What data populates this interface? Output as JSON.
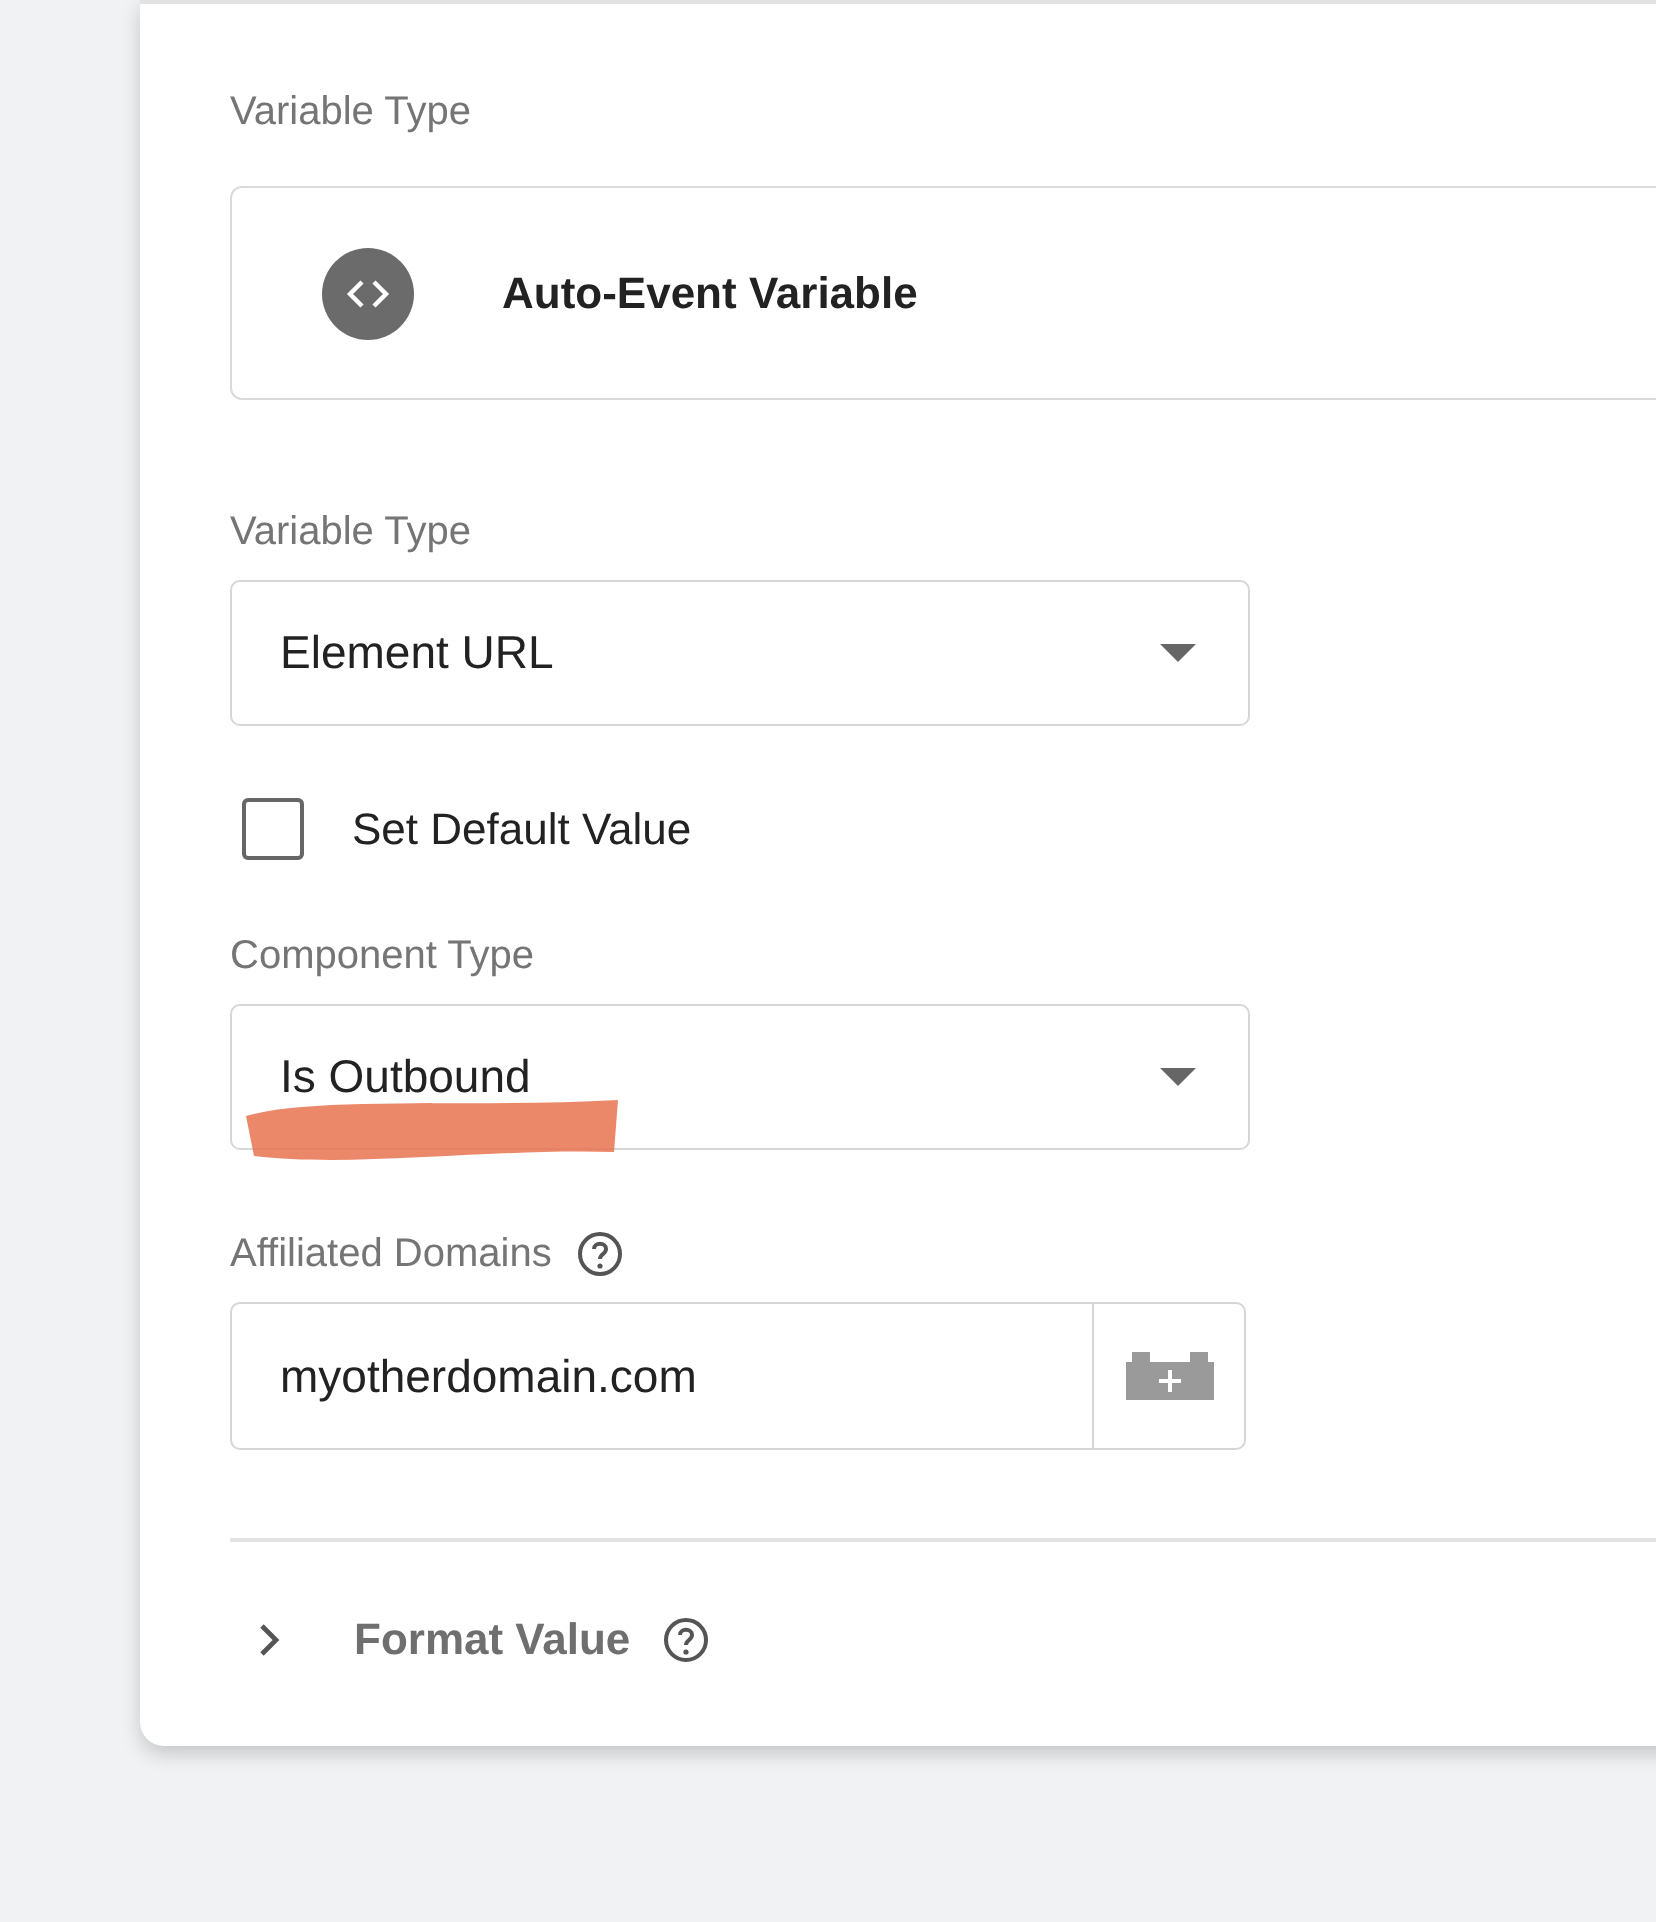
{
  "variable_type_card": {
    "label": "Variable Type",
    "name": "Auto-Event Variable"
  },
  "variable_type": {
    "label": "Variable Type",
    "value": "Element URL"
  },
  "set_default_value": {
    "label": "Set Default Value",
    "checked": false
  },
  "component_type": {
    "label": "Component Type",
    "value": "Is Outbound"
  },
  "affiliated_domains": {
    "label": "Affiliated Domains",
    "value": "myotherdomain.com"
  },
  "format_value": {
    "label": "Format Value",
    "expanded": false
  }
}
